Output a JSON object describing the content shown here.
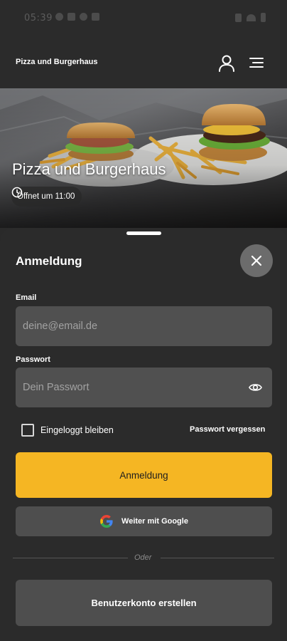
{
  "status_bar": {
    "time": "05:39"
  },
  "header": {
    "app_title": "Pizza und Burgerhaus",
    "user_icon": "user-icon",
    "menu_icon": "hamburger-menu-icon"
  },
  "hero": {
    "restaurant_name": "Pizza und Burgerhaus",
    "opening_hours": "Öffnet um 11:00",
    "clock_icon": "clock-icon"
  },
  "login_sheet": {
    "title": "Anmeldung",
    "close_icon": "close-icon",
    "email": {
      "label": "Email",
      "placeholder": "deine@email.de",
      "value": ""
    },
    "password": {
      "label": "Passwort",
      "placeholder": "Dein Passwort",
      "value": "",
      "visibility_icon": "eye-icon"
    },
    "remember_me": {
      "label": "Eingeloggt bleiben",
      "checked": false
    },
    "forgot_password": "Passwort vergessen",
    "login_button": "Anmeldung",
    "google_button": "Weiter mit Google",
    "divider_text": "Oder",
    "create_account_button": "Benutzerkonto erstellen"
  },
  "colors": {
    "background": "#2b2b2b",
    "input_background": "#505050",
    "accent": "#f5b623",
    "secondary_button": "#4e4e4e",
    "close_button": "#6c6c6c"
  }
}
